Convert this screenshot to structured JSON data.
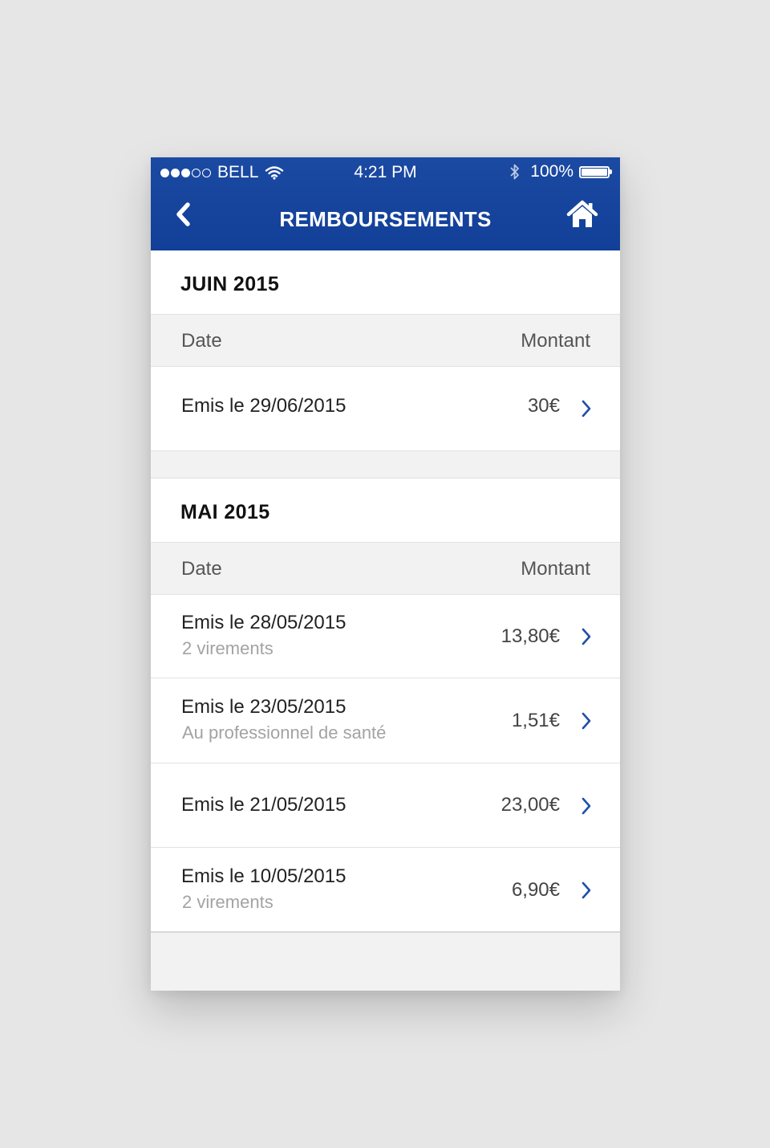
{
  "status_bar": {
    "carrier": "BELL",
    "time": "4:21 PM",
    "battery": "100%",
    "signal_full": 3,
    "signal_total": 5
  },
  "nav": {
    "title": "REMBOURSEMENTS",
    "back_icon": "chevron-left-icon",
    "home_icon": "home-icon"
  },
  "colors": {
    "header_blue": "#16459d",
    "chevron_blue": "#1f4fa8",
    "subtext_gray": "#a3a3a3"
  },
  "sections": [
    {
      "title": "JUIN 2015",
      "col_date": "Date",
      "col_amount": "Montant",
      "rows": [
        {
          "date": "Emis le 29/06/2015",
          "sub": "",
          "amount": "30€"
        }
      ]
    },
    {
      "title": "MAI 2015",
      "col_date": "Date",
      "col_amount": "Montant",
      "rows": [
        {
          "date": "Emis le 28/05/2015",
          "sub": "2 virements",
          "amount": "13,80€"
        },
        {
          "date": "Emis le 23/05/2015",
          "sub": "Au professionnel de santé",
          "amount": "1,51€"
        },
        {
          "date": "Emis le 21/05/2015",
          "sub": "",
          "amount": "23,00€"
        },
        {
          "date": "Emis le 10/05/2015",
          "sub": "2 virements",
          "amount": "6,90€"
        }
      ]
    }
  ]
}
